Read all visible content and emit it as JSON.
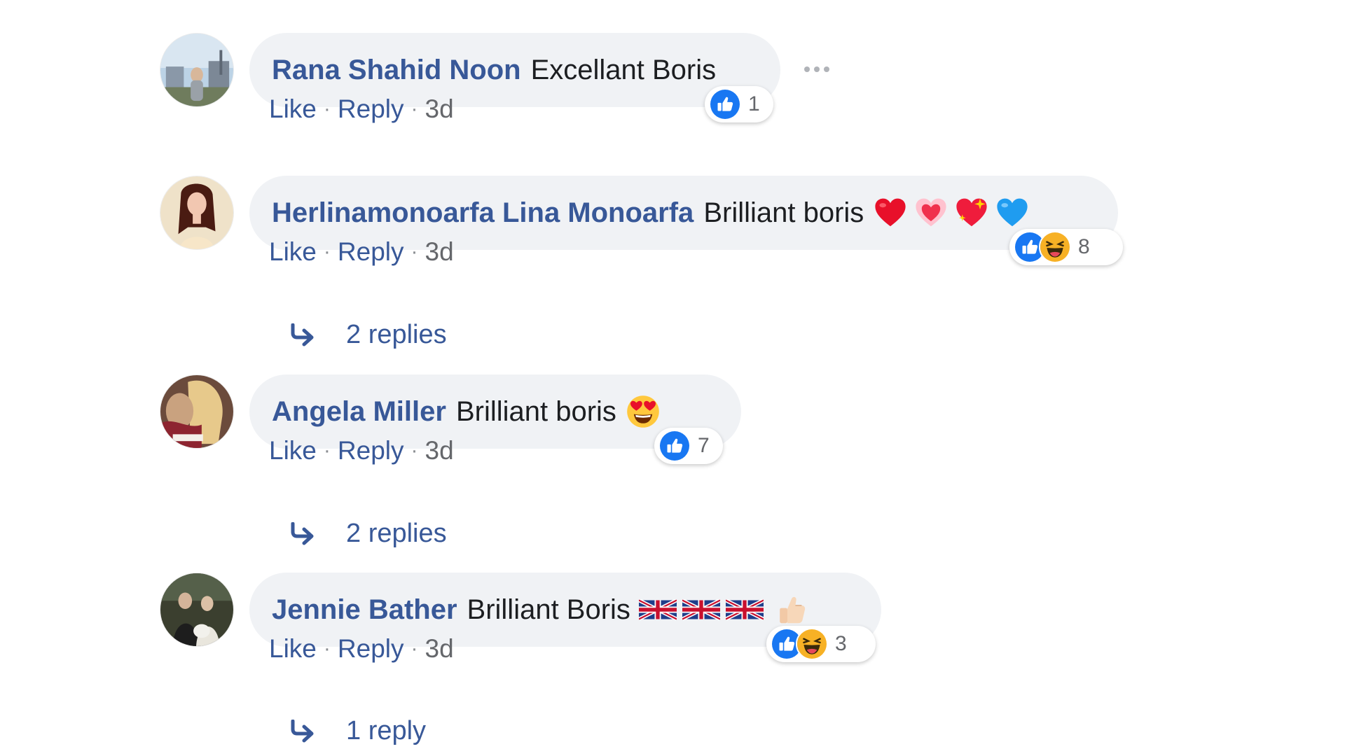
{
  "comments": [
    {
      "author": "Rana Shahid Noon",
      "text": "Excellant Boris",
      "emojis": [],
      "reaction_count": "1",
      "reaction_icons": [
        "like-icon"
      ],
      "actions": {
        "like": "Like",
        "reply": "Reply",
        "time": "3d"
      },
      "replies_label": ""
    },
    {
      "author": "Herlinamonoarfa Lina Monoarfa",
      "text": "Brilliant boris",
      "emojis": [
        "red-heart-emoji",
        "heart-emoji",
        "sparkling-heart-emoji",
        "blue-heart-emoji"
      ],
      "reaction_count": "8",
      "reaction_icons": [
        "like-icon",
        "haha-icon"
      ],
      "actions": {
        "like": "Like",
        "reply": "Reply",
        "time": "3d"
      },
      "replies_label": "2 replies"
    },
    {
      "author": "Angela Miller",
      "text": "Brilliant boris",
      "emojis": [
        "heart-eyes-emoji"
      ],
      "reaction_count": "7",
      "reaction_icons": [
        "like-icon"
      ],
      "actions": {
        "like": "Like",
        "reply": "Reply",
        "time": "3d"
      },
      "replies_label": "2 replies"
    },
    {
      "author": "Jennie Bather",
      "text": "Brilliant Boris",
      "emojis": [
        "uk-flag-emoji",
        "uk-flag-emoji",
        "uk-flag-emoji",
        "thumbs-up-emoji"
      ],
      "reaction_count": "3",
      "reaction_icons": [
        "like-icon",
        "haha-icon"
      ],
      "actions": {
        "like": "Like",
        "reply": "Reply",
        "time": "3d"
      },
      "replies_label": "1 reply"
    }
  ],
  "colors": {
    "author_link": "#385898",
    "bubble_bg": "#f0f2f5",
    "like_blue": "#1877f2",
    "meta_gray": "#65676b"
  }
}
